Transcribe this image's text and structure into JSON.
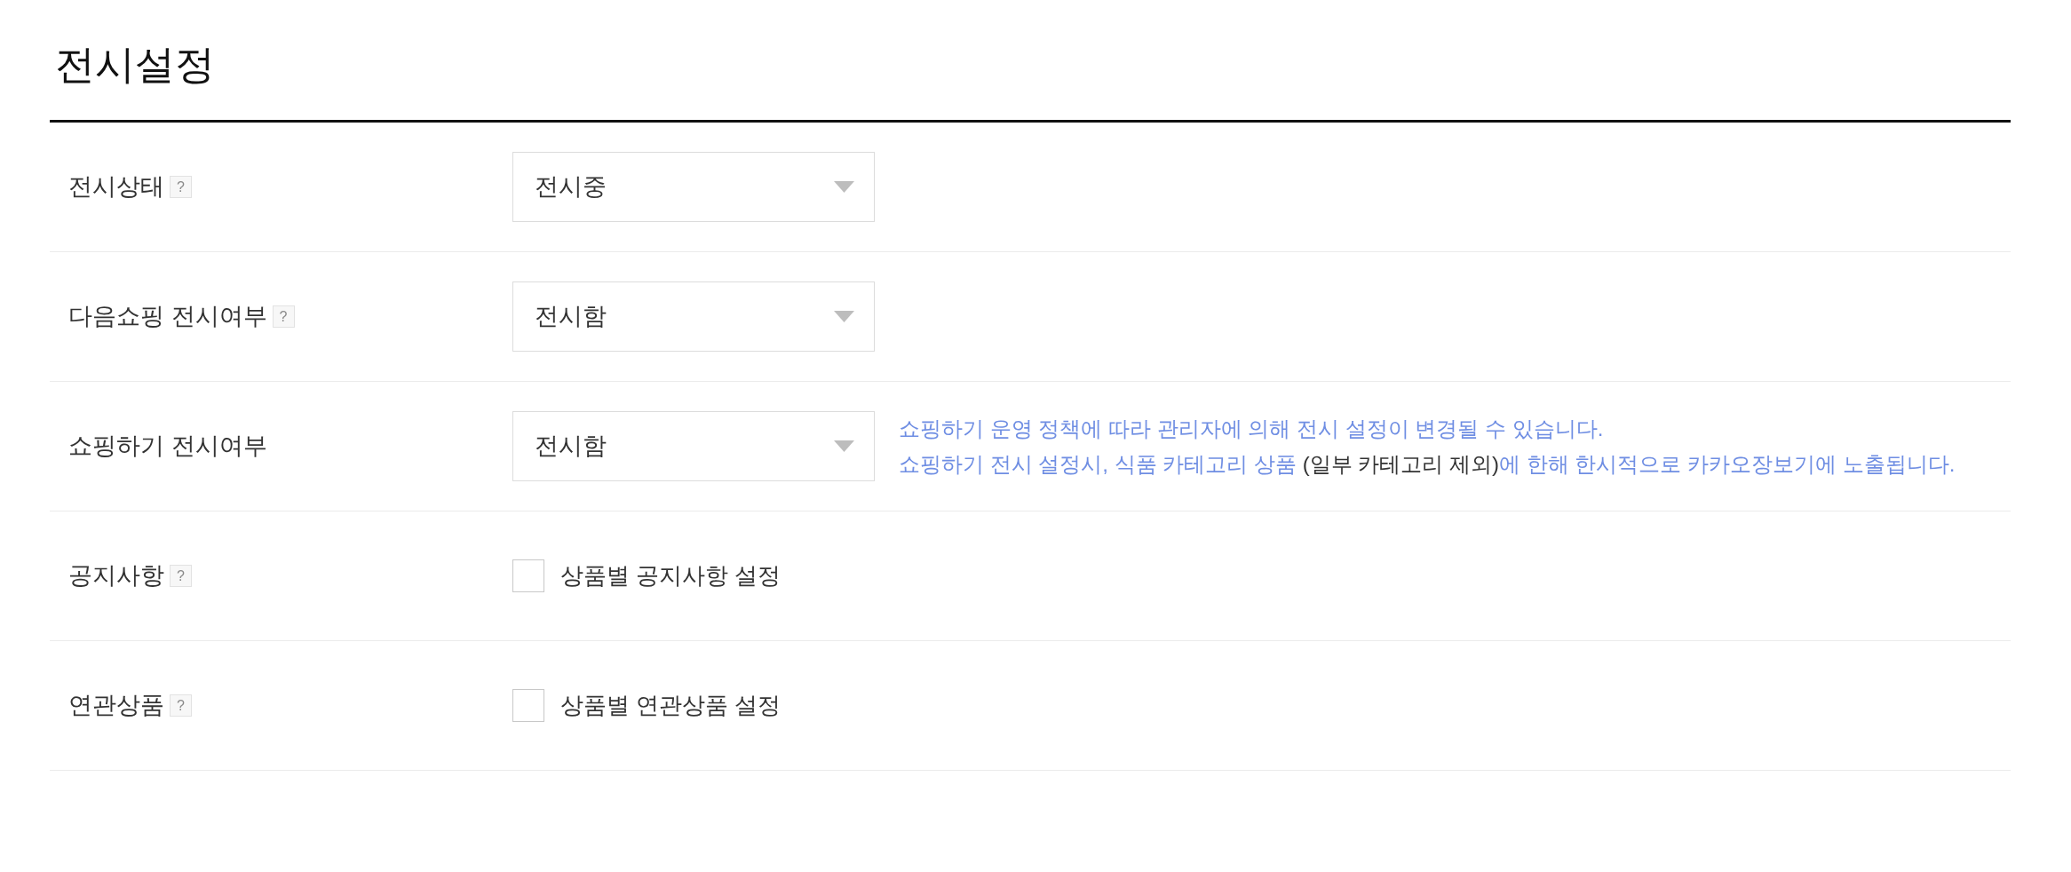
{
  "title": "전시설정",
  "fields": [
    {
      "label": "전시상태",
      "help": "?",
      "kind": "select",
      "value": "전시중"
    },
    {
      "label": "다음쇼핑 전시여부",
      "help": "?",
      "kind": "select",
      "value": "전시함"
    },
    {
      "label": "쇼핑하기 전시여부",
      "kind": "select",
      "value": "전시함",
      "note": [
        [
          {
            "kind": "info",
            "text": "쇼핑하기 운영 정책에 따라 관리자에 의해 전시 설정이 변경될 수 있습니다."
          }
        ],
        [
          {
            "kind": "info",
            "text": "쇼핑하기 전시 설정시, 식품 카테고리 상품 "
          },
          {
            "kind": "plain",
            "text": "(일부 카테고리 제외)"
          },
          {
            "kind": "info",
            "text": "에 한해 한시적으로 카카오장보기에 노출됩니다."
          }
        ]
      ]
    },
    {
      "label": "공지사항",
      "help": "?",
      "kind": "checkbox",
      "checked": false,
      "text": "상품별 공지사항 설정"
    },
    {
      "label": "연관상품",
      "help": "?",
      "kind": "checkbox",
      "checked": false,
      "text": "상품별 연관상품 설정"
    }
  ]
}
